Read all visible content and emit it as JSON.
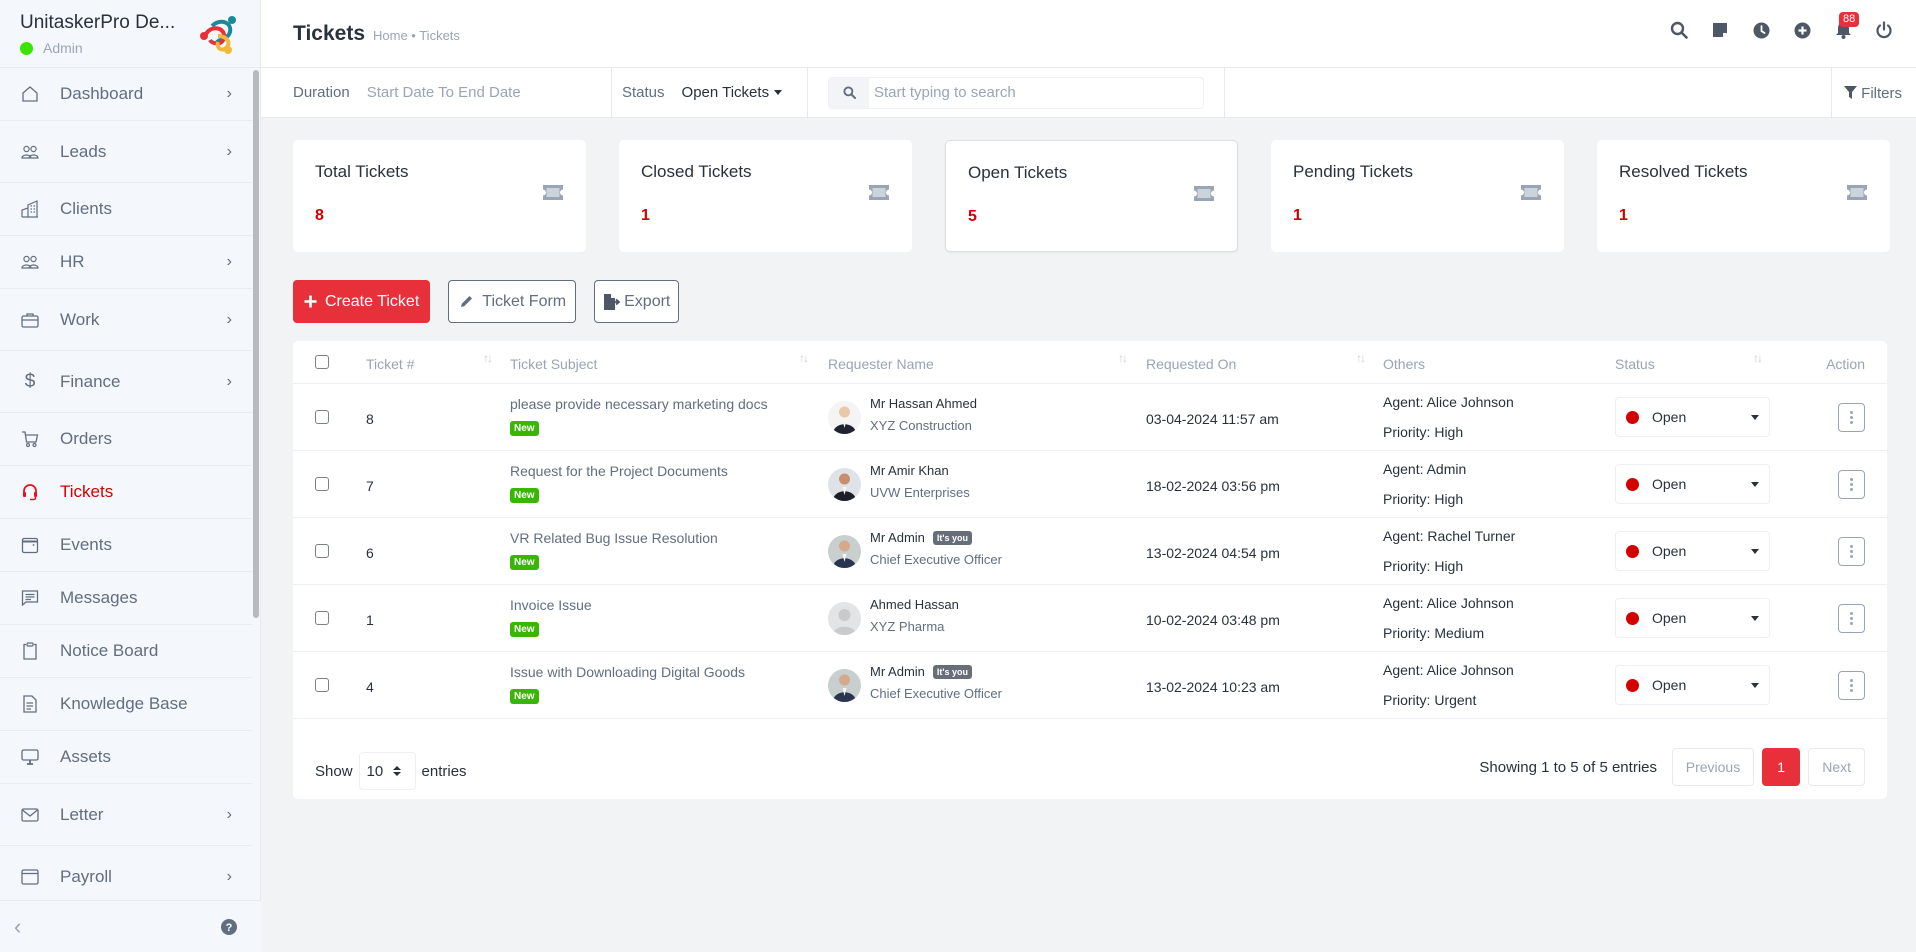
{
  "brand": {
    "name": "UnitaskerPro De...",
    "role": "Admin",
    "status_color": "#39e500"
  },
  "sidebar": {
    "items": [
      {
        "label": "Dashboard",
        "icon": "home-icon",
        "has_children": true
      },
      {
        "label": "Leads",
        "icon": "users-icon",
        "has_children": true
      },
      {
        "label": "Clients",
        "icon": "building-icon",
        "has_children": false
      },
      {
        "label": "HR",
        "icon": "users-icon",
        "has_children": true
      },
      {
        "label": "Work",
        "icon": "briefcase-icon",
        "has_children": true
      },
      {
        "label": "Finance",
        "icon": "dollar-icon",
        "has_children": true
      },
      {
        "label": "Orders",
        "icon": "cart-icon",
        "has_children": false
      },
      {
        "label": "Tickets",
        "icon": "headset-icon",
        "has_children": false,
        "active": true
      },
      {
        "label": "Events",
        "icon": "calendar-icon",
        "has_children": false
      },
      {
        "label": "Messages",
        "icon": "message-icon",
        "has_children": false
      },
      {
        "label": "Notice Board",
        "icon": "clipboard-icon",
        "has_children": false
      },
      {
        "label": "Knowledge Base",
        "icon": "document-icon",
        "has_children": false
      },
      {
        "label": "Assets",
        "icon": "monitor-icon",
        "has_children": false
      },
      {
        "label": "Letter",
        "icon": "envelope-icon",
        "has_children": true
      },
      {
        "label": "Payroll",
        "icon": "window-icon",
        "has_children": true
      }
    ],
    "collapse_icon": "chevron-left-icon",
    "help_icon": "question-circle-icon"
  },
  "header": {
    "title": "Tickets",
    "breadcrumb": "Home • Tickets",
    "notification_count": "88",
    "icons": [
      "search-icon",
      "sticky-note-icon",
      "clock-icon",
      "plus-circle-icon",
      "bell-icon",
      "power-icon"
    ]
  },
  "filters": {
    "duration_label": "Duration",
    "duration_value": "Start Date To End Date",
    "status_label": "Status",
    "status_value": "Open Tickets",
    "search_placeholder": "Start typing to search",
    "filters_label": "Filters"
  },
  "stats": [
    {
      "title": "Total Tickets",
      "value": "8"
    },
    {
      "title": "Closed Tickets",
      "value": "1"
    },
    {
      "title": "Open Tickets",
      "value": "5",
      "selected": true
    },
    {
      "title": "Pending Tickets",
      "value": "1"
    },
    {
      "title": "Resolved Tickets",
      "value": "1"
    }
  ],
  "actions": {
    "create": "Create Ticket",
    "form": "Ticket Form",
    "export": "Export"
  },
  "table": {
    "columns": [
      "Ticket #",
      "Ticket Subject",
      "Requester Name",
      "Requested On",
      "Others",
      "Status",
      "Action"
    ],
    "rows": [
      {
        "id": "8",
        "subject": "please provide necessary marketing docs",
        "badge": "New",
        "requester": "Mr Hassan Ahmed",
        "org": "XYZ Construction",
        "is_you": false,
        "requested_on": "03-04-2024 11:57 am",
        "agent": "Agent: Alice Johnson",
        "priority": "Priority: High",
        "status": "Open"
      },
      {
        "id": "7",
        "subject": "Request for the Project Documents",
        "badge": "New",
        "requester": "Mr Amir Khan",
        "org": "UVW Enterprises",
        "is_you": false,
        "requested_on": "18-02-2024 03:56 pm",
        "agent": "Agent: Admin",
        "priority": "Priority: High",
        "status": "Open"
      },
      {
        "id": "6",
        "subject": "VR Related Bug Issue Resolution",
        "badge": "New",
        "requester": "Mr Admin",
        "org": "Chief Executive Officer",
        "is_you": true,
        "you_label": "It's you",
        "requested_on": "13-02-2024 04:54 pm",
        "agent": "Agent: Rachel Turner",
        "priority": "Priority: High",
        "status": "Open"
      },
      {
        "id": "1",
        "subject": "Invoice Issue",
        "badge": "New",
        "requester": "Ahmed Hassan",
        "org": "XYZ Pharma",
        "is_you": false,
        "requested_on": "10-02-2024 03:48 pm",
        "agent": "Agent: Alice Johnson",
        "priority": "Priority: Medium",
        "status": "Open"
      },
      {
        "id": "4",
        "subject": "Issue with Downloading Digital Goods",
        "badge": "New",
        "requester": "Mr Admin",
        "org": "Chief Executive Officer",
        "is_you": true,
        "you_label": "It's you",
        "requested_on": "13-02-2024 10:23 am",
        "agent": "Agent: Alice Johnson",
        "priority": "Priority: Urgent",
        "status": "Open"
      }
    ],
    "footer": {
      "show": "Show",
      "entries_value": "10",
      "entries": "entries",
      "info": "Showing 1 to 5 of 5 entries",
      "previous": "Previous",
      "page": "1",
      "next": "Next"
    }
  },
  "colors": {
    "accent": "#e8303b",
    "status_open": "#d30000",
    "new_badge": "#39b700"
  }
}
